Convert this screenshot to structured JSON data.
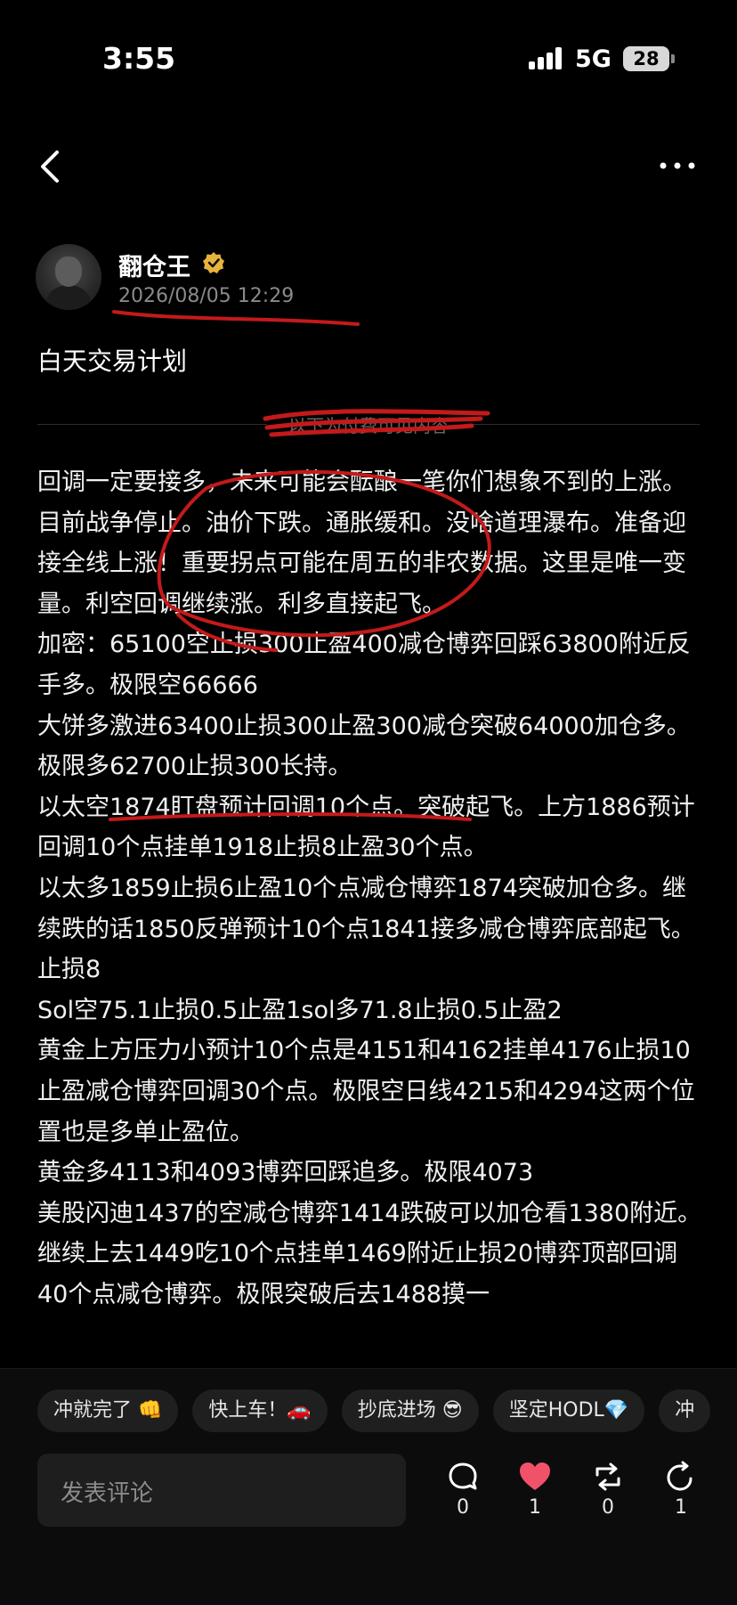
{
  "status_bar": {
    "time": "3:55",
    "network": "5G",
    "battery": "28"
  },
  "author": {
    "name": "翻仓王",
    "date": "2026/08/05 12:29"
  },
  "post": {
    "title": "白天交易计划",
    "divider_label": "以下为付费可见内容",
    "paragraphs": [
      "回调一定要接多，未来可能会酝酿一笔你们想象不到的上涨。目前战争停止。油价下跌。通胀缓和。没啥道理瀑布。准备迎接全线上涨！重要拐点可能在周五的非农数据。这里是唯一变量。利空回调继续涨。利多直接起飞。",
      "加密：65100空止损300止盈400减仓博弈回踩63800附近反手多。极限空66666",
      "大饼多激进63400止损300止盈300减仓突破64000加仓多。极限多62700止损300长持。",
      "以太空1874盯盘预计回调10个点。突破起飞。上方1886预计回调10个点挂单1918止损8止盈30个点。",
      "以太多1859止损6止盈10个点减仓博弈1874突破加仓多。继续跌的话1850反弹预计10个点1841接多减仓博弈底部起飞。止损8",
      "Sol空75.1止损0.5止盈1sol多71.8止损0.5止盈2",
      "黄金上方压力小预计10个点是4151和4162挂单4176止损10止盈减仓博弈回调30个点。极限空日线4215和4294这两个位置也是多单止盈位。",
      "黄金多4113和4093博弈回踩追多。极限4073",
      "美股闪迪1437的空减仓博弈1414跌破可以加仓看1380附近。继续上去1449吃10个点挂单1469附近止损20博弈顶部回调40个点减仓博弈。极限突破后去1488摸一"
    ]
  },
  "quick_replies": [
    "冲就完了 👊",
    "快上车！🚗",
    "抄底进场 😎",
    "坚定HODL💎",
    "冲"
  ],
  "comment": {
    "placeholder": "发表评论"
  },
  "actions": {
    "comment_count": "0",
    "like_count": "1",
    "repost_count": "0",
    "share_count": "1"
  },
  "icons": {
    "back": "chevron-left-icon",
    "more": "more-dots-icon",
    "verified": "verified-badge-icon",
    "comment": "comment-bubble-icon",
    "like": "heart-icon",
    "repost": "repost-icon",
    "share": "share-icon"
  },
  "colors": {
    "background": "#000000",
    "like": "#f0526a",
    "verified": "#e7b43a",
    "annotation": "#c41a1a"
  }
}
